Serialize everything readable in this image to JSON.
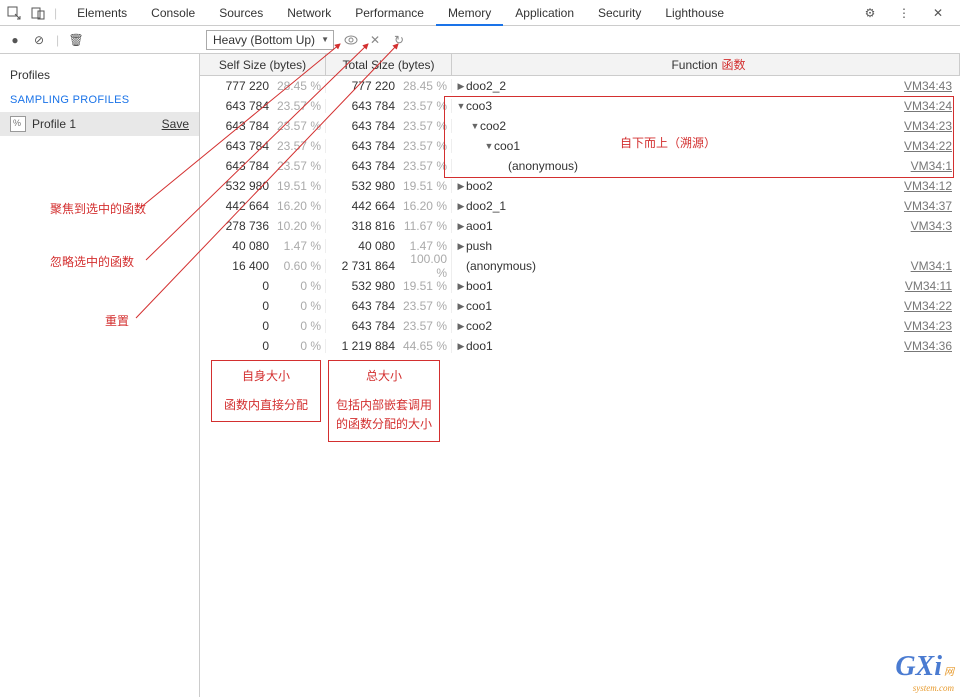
{
  "topbar": {
    "tabs": [
      "Elements",
      "Console",
      "Sources",
      "Network",
      "Performance",
      "Memory",
      "Application",
      "Security",
      "Lighthouse"
    ],
    "active_tab": "Memory"
  },
  "toolbar": {
    "dropdown": "Heavy (Bottom Up)"
  },
  "sidebar": {
    "header": "Profiles",
    "section": "SAMPLING PROFILES",
    "profile_name": "Profile 1",
    "save_label": "Save"
  },
  "columns": {
    "self": "Self Size (bytes)",
    "total": "Total Size (bytes)",
    "func": "Function",
    "func_zh": "函数"
  },
  "rows": [
    {
      "self": "777 220",
      "self_pct": "28.45 %",
      "total": "777 220",
      "total_pct": "28.45 %",
      "func": "doo2_2",
      "link": "VM34:43",
      "indent": 0,
      "tw": "▶"
    },
    {
      "self": "643 784",
      "self_pct": "23.57 %",
      "total": "643 784",
      "total_pct": "23.57 %",
      "func": "coo3",
      "link": "VM34:24",
      "indent": 0,
      "tw": "▼"
    },
    {
      "self": "643 784",
      "self_pct": "23.57 %",
      "total": "643 784",
      "total_pct": "23.57 %",
      "func": "coo2",
      "link": "VM34:23",
      "indent": 1,
      "tw": "▼"
    },
    {
      "self": "643 784",
      "self_pct": "23.57 %",
      "total": "643 784",
      "total_pct": "23.57 %",
      "func": "coo1",
      "link": "VM34:22",
      "indent": 2,
      "tw": "▼"
    },
    {
      "self": "643 784",
      "self_pct": "23.57 %",
      "total": "643 784",
      "total_pct": "23.57 %",
      "func": "(anonymous)",
      "link": "VM34:1",
      "indent": 3,
      "tw": ""
    },
    {
      "self": "532 980",
      "self_pct": "19.51 %",
      "total": "532 980",
      "total_pct": "19.51 %",
      "func": "boo2",
      "link": "VM34:12",
      "indent": 0,
      "tw": "▶"
    },
    {
      "self": "442 664",
      "self_pct": "16.20 %",
      "total": "442 664",
      "total_pct": "16.20 %",
      "func": "doo2_1",
      "link": "VM34:37",
      "indent": 0,
      "tw": "▶"
    },
    {
      "self": "278 736",
      "self_pct": "10.20 %",
      "total": "318 816",
      "total_pct": "11.67 %",
      "func": "aoo1",
      "link": "VM34:3",
      "indent": 0,
      "tw": "▶"
    },
    {
      "self": "40 080",
      "self_pct": "1.47 %",
      "total": "40 080",
      "total_pct": "1.47 %",
      "func": "push",
      "link": "",
      "indent": 0,
      "tw": "▶"
    },
    {
      "self": "16 400",
      "self_pct": "0.60 %",
      "total": "2 731 864",
      "total_pct": "100.00 %",
      "func": "(anonymous)",
      "link": "VM34:1",
      "indent": 0,
      "tw": ""
    },
    {
      "self": "0",
      "self_pct": "0 %",
      "total": "532 980",
      "total_pct": "19.51 %",
      "func": "boo1",
      "link": "VM34:11",
      "indent": 0,
      "tw": "▶"
    },
    {
      "self": "0",
      "self_pct": "0 %",
      "total": "643 784",
      "total_pct": "23.57 %",
      "func": "coo1",
      "link": "VM34:22",
      "indent": 0,
      "tw": "▶"
    },
    {
      "self": "0",
      "self_pct": "0 %",
      "total": "643 784",
      "total_pct": "23.57 %",
      "func": "coo2",
      "link": "VM34:23",
      "indent": 0,
      "tw": "▶"
    },
    {
      "self": "0",
      "self_pct": "0 %",
      "total": "1 219 884",
      "total_pct": "44.65 %",
      "func": "doo1",
      "link": "VM34:36",
      "indent": 0,
      "tw": "▶"
    }
  ],
  "annotations": {
    "focus": "聚焦到选中的函数",
    "ignore": "忽略选中的函数",
    "reset": "重置",
    "bottom_up": "自下而上（溯源）",
    "self_box_l1": "自身大小",
    "self_box_l2": "函数内直接分配",
    "total_box_l1": "总大小",
    "total_box_l2": "包括内部嵌套调用的函数分配的大小"
  },
  "watermark": {
    "big": "GXi",
    "sm": "网",
    "sub": "system.com"
  }
}
